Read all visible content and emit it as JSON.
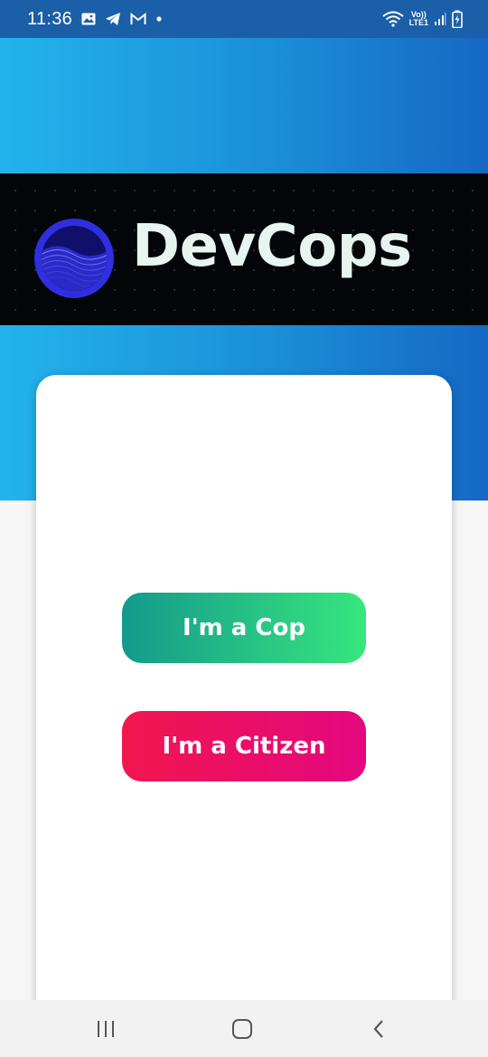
{
  "status_bar": {
    "time": "11:36",
    "network_label_top": "Vo))",
    "network_label_bottom": "LTE1",
    "icons": [
      "gallery-icon",
      "telegram-icon",
      "gmail-icon",
      "dot-icon",
      "wifi-icon",
      "signal-icon",
      "battery-charging-icon"
    ]
  },
  "banner": {
    "logo_text": "DevCops",
    "logo_icon": "wave-sphere-logo-icon"
  },
  "actions": {
    "cop_label": "I'm a Cop",
    "citizen_label": "I'm a Citizen"
  },
  "navigation": {
    "icons": [
      "recent-apps-icon",
      "home-icon",
      "back-icon"
    ]
  },
  "colors": {
    "header_blue": "#1b8fd9",
    "cop_gradient": [
      "#139a8b",
      "#38e67e"
    ],
    "citizen_gradient": [
      "#f2164f",
      "#e3077f"
    ],
    "banner_bg": "#020608"
  }
}
